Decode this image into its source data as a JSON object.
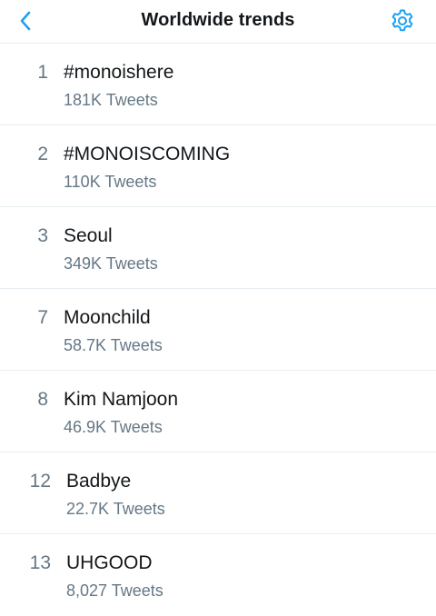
{
  "header": {
    "title": "Worldwide trends",
    "back_icon": "chevron-left-icon",
    "settings_icon": "gear-icon",
    "accent_color": "#1da1f2"
  },
  "trends": [
    {
      "rank": "1",
      "name": "#monoishere",
      "count": "181K Tweets"
    },
    {
      "rank": "2",
      "name": "#MONOISCOMING",
      "count": "110K Tweets"
    },
    {
      "rank": "3",
      "name": "Seoul",
      "count": "349K Tweets"
    },
    {
      "rank": "7",
      "name": "Moonchild",
      "count": "58.7K Tweets"
    },
    {
      "rank": "8",
      "name": "Kim Namjoon",
      "count": "46.9K Tweets"
    },
    {
      "rank": "12",
      "name": "Badbye",
      "count": "22.7K Tweets"
    },
    {
      "rank": "13",
      "name": "UHGOOD",
      "count": "8,027 Tweets"
    }
  ]
}
